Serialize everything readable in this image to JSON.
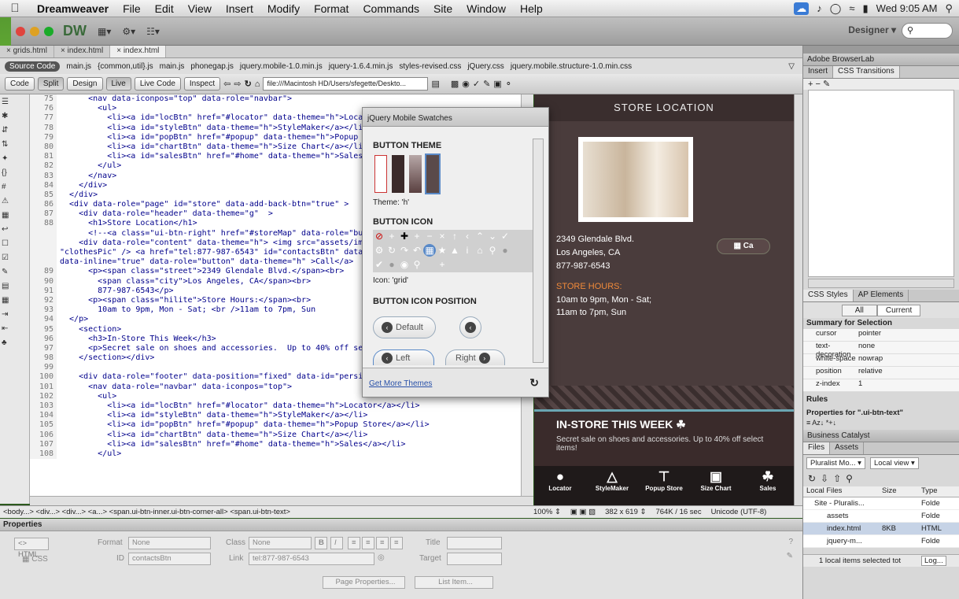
{
  "menubar": {
    "app": "Dreamweaver",
    "items": [
      "File",
      "Edit",
      "View",
      "Insert",
      "Modify",
      "Format",
      "Commands",
      "Site",
      "Window",
      "Help"
    ],
    "clock": "Wed 9:05 AM"
  },
  "titlebar": {
    "logo": "DW",
    "workspace": "Designer"
  },
  "doc_tabs": [
    "grids.html",
    "index.html",
    "index.html"
  ],
  "related_files": [
    "Source Code",
    "main.js",
    "{common,util}.js",
    "main.js",
    "phonegap.js",
    "jquery.mobile-1.0.min.js",
    "jquery-1.6.4.min.js",
    "styles-revised.css",
    "jQuery.css",
    "jquery.mobile.structure-1.0.min.css"
  ],
  "view_buttons": [
    "Code",
    "Split",
    "Design",
    "Live",
    "Live Code",
    "Inspect"
  ],
  "address": "file:///Macintosh HD/Users/sfegette/Deskto...",
  "code_lines": [
    {
      "n": "75",
      "t": "      <nav data-iconpos=\"top\" data-role=\"navbar\">"
    },
    {
      "n": "76",
      "t": "        <ul>"
    },
    {
      "n": "77",
      "t": "          <li><a id=\"locBtn\" href=\"#locator\" data-theme=\"h\">Locator"
    },
    {
      "n": "78",
      "t": "          <li><a id=\"styleBtn\" data-theme=\"h\">StyleMaker</a></li>"
    },
    {
      "n": "79",
      "t": "          <li><a id=\"popBtn\" href=\"#popup\" data-theme=\"h\">Popup Sto"
    },
    {
      "n": "80",
      "t": "          <li><a id=\"chartBtn\" data-theme=\"h\">Size Chart</a></li>"
    },
    {
      "n": "81",
      "t": "          <li><a id=\"salesBtn\" href=\"#home\" data-theme=\"h\">Sales</a"
    },
    {
      "n": "82",
      "t": "        </ul>"
    },
    {
      "n": "83",
      "t": "      </nav>"
    },
    {
      "n": "84",
      "t": "    </div>"
    },
    {
      "n": "85",
      "t": "  </div>"
    },
    {
      "n": "86",
      "t": "  <div data-role=\"page\" id=\"store\" data-add-back-btn=\"true\" >"
    },
    {
      "n": "87",
      "t": "    <div data-role=\"header\" data-theme=\"g\"  >"
    },
    {
      "n": "88",
      "t": "      <h1>Store Location</h1>"
    },
    {
      "n": "",
      "t": "      <!--<a class=\"ui-btn-right\" href=\"#storeMap\" data-role=\"butto"
    },
    {
      "n": "",
      "t": "    <div data-role=\"content\" data-theme=\"h\"> <img src=\"assets/img/c"
    },
    {
      "n": "",
      "t": "\"clothesPic\" /> <a href=\"tel:877-987-6543\" id=\"contactsBtn\" data-"
    },
    {
      "n": "",
      "t": "data-inline=\"true\" data-role=\"button\" data-theme=\"h\" >Call</a>"
    },
    {
      "n": "89",
      "t": "      <p><span class=\"street\">2349 Glendale Blvd.</span><br>"
    },
    {
      "n": "90",
      "t": "        <span class=\"city\">Los Angeles, CA</span><br>"
    },
    {
      "n": "91",
      "t": "        877-987-6543</p>"
    },
    {
      "n": "92",
      "t": "      <p><span class=\"hilite\">Store Hours:</span><br>"
    },
    {
      "n": "93",
      "t": "        10am to 9pm, Mon - Sat; <br />11am to 7pm, Sun"
    },
    {
      "n": "94",
      "t": "  </p>"
    },
    {
      "n": "95",
      "t": "    <section>"
    },
    {
      "n": "96",
      "t": "      <h3>In-Store This Week</h3>"
    },
    {
      "n": "97",
      "t": "      <p>Secret sale on shoes and accessories.  Up to 40% off selec"
    },
    {
      "n": "98",
      "t": "    </section></div>"
    },
    {
      "n": "99",
      "t": ""
    },
    {
      "n": "100",
      "t": "    <div data-role=\"footer\" data-position=\"fixed\" data-id=\"persistantFooter\">"
    },
    {
      "n": "101",
      "t": "      <nav data-role=\"navbar\" data-iconpos=\"top\">"
    },
    {
      "n": "102",
      "t": "        <ul>"
    },
    {
      "n": "103",
      "t": "          <li><a id=\"locBtn\" href=\"#locator\" data-theme=\"h\">Locator</a></li>"
    },
    {
      "n": "104",
      "t": "          <li><a id=\"styleBtn\" data-theme=\"h\">StyleMaker</a></li>"
    },
    {
      "n": "105",
      "t": "          <li><a id=\"popBtn\" href=\"#popup\" data-theme=\"h\">Popup Store</a></li>"
    },
    {
      "n": "106",
      "t": "          <li><a id=\"chartBtn\" data-theme=\"h\">Size Chart</a></li>"
    },
    {
      "n": "107",
      "t": "          <li><a id=\"salesBtn\" href=\"#home\" data-theme=\"h\">Sales</a></li>"
    },
    {
      "n": "108",
      "t": "        </ul>"
    }
  ],
  "swatches": {
    "title": "jQuery Mobile Swatches",
    "button_theme": "BUTTON THEME",
    "theme_label": "Theme: 'h'",
    "button_icon": "BUTTON ICON",
    "icon_label": "Icon: 'grid'",
    "icon_position": "BUTTON ICON POSITION",
    "default_label": "Default",
    "left_label": "Left",
    "right_label": "Right",
    "more_themes": "Get More Themes"
  },
  "live": {
    "header": "STORE LOCATION",
    "street": "2349 Glendale Blvd.",
    "city": "Los Angeles, CA",
    "phone": "877-987-6543",
    "call": "Ca",
    "hours_title": "STORE HOURS:",
    "hours1": "10am to 9pm, Mon - Sat;",
    "hours2": "11am to 7pm, Sun",
    "instore_title": "IN-STORE THIS WEEK",
    "instore_text": "Secret sale on shoes and accessories. Up to 40% off select items!",
    "nav": [
      {
        "label": "Locator",
        "icon": "map-pin-icon"
      },
      {
        "label": "StyleMaker",
        "icon": "hanger-icon"
      },
      {
        "label": "Popup Store",
        "icon": "hammer-icon"
      },
      {
        "label": "Size Chart",
        "icon": "shirt-icon"
      },
      {
        "label": "Sales",
        "icon": "tag-icon"
      }
    ]
  },
  "tag_selector": "<body...> <div...> <div...> <a...> <span.ui-btn-inner.ui-btn-corner-all> <span.ui-btn-text>",
  "status": {
    "zoom": "100%",
    "size": "382 x 619",
    "stats": "764K / 16 sec",
    "encoding": "Unicode (UTF-8)"
  },
  "properties": {
    "title": "Properties",
    "html": "HTML",
    "css": "CSS",
    "format_label": "Format",
    "format": "None",
    "class_label": "Class",
    "class": "None",
    "id_label": "ID",
    "id": "contactsBtn",
    "link_label": "Link",
    "link": "tel:877-987-6543",
    "title_label": "Title",
    "target_label": "Target",
    "page_props": "Page Properties...",
    "list_item": "List Item..."
  },
  "right": {
    "browserlab": "Adobe BrowserLab",
    "insert": "Insert",
    "transitions": "CSS Transitions",
    "css_styles": "CSS Styles",
    "ap": "AP Elements",
    "all": "All",
    "current": "Current",
    "summary": "Summary for Selection",
    "props": [
      [
        "cursor",
        "pointer"
      ],
      [
        "text-decoration",
        "none"
      ],
      [
        "white-space",
        "nowrap"
      ],
      [
        "position",
        "relative"
      ],
      [
        "z-index",
        "1"
      ]
    ],
    "rules": "Rules",
    "props_for": "Properties for \".ui-btn-text\"",
    "bc": "Business Catalyst",
    "files": "Files",
    "assets": "Assets",
    "site": "Pluralist Mo...",
    "view": "Local view",
    "local_files": "Local Files",
    "size_col": "Size",
    "type_col": "Type",
    "tree": [
      {
        "name": "Site - Pluralis...",
        "size": "",
        "type": "Folde"
      },
      {
        "name": "assets",
        "size": "",
        "type": "Folde"
      },
      {
        "name": "index.html",
        "size": "8KB",
        "type": "HTML"
      },
      {
        "name": "jquery-m...",
        "size": "",
        "type": "Folde"
      }
    ],
    "status": "1 local items selected tot",
    "log": "Log..."
  }
}
